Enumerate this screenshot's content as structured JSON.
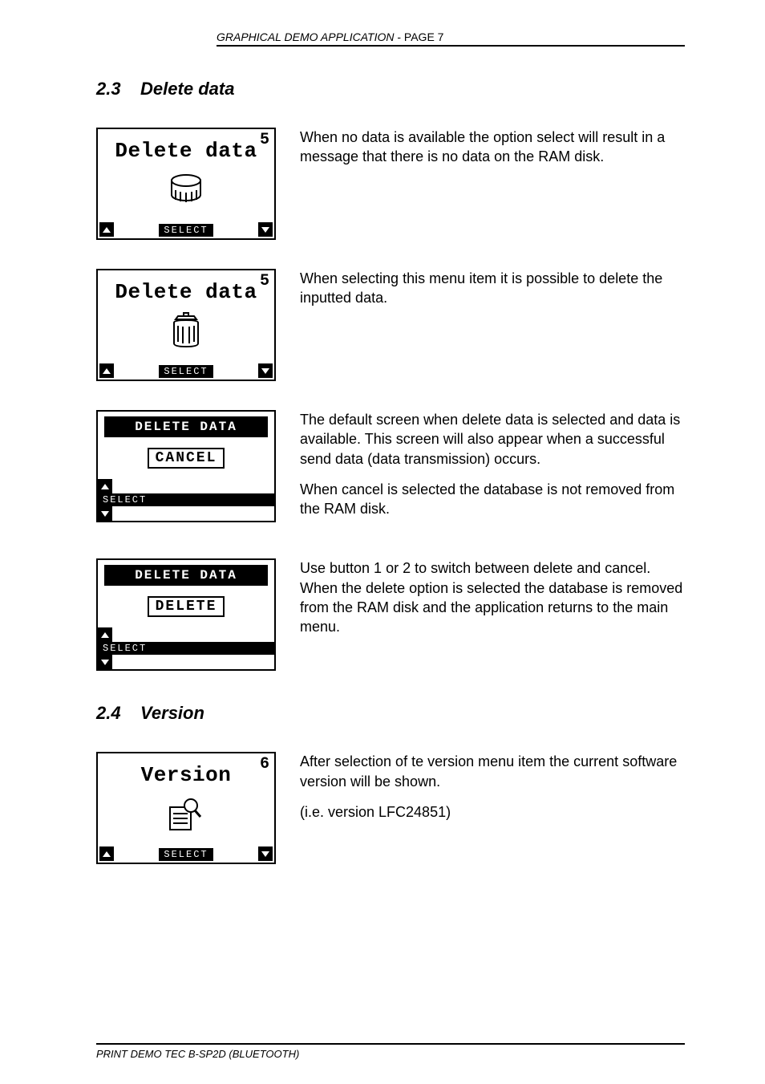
{
  "header": {
    "left_italic": "GRAPHICAL DEMO APPLICATION",
    "separator": "   -   ",
    "right": "PAGE 7"
  },
  "sections": {
    "delete": {
      "num": "2.3",
      "title": "Delete data"
    },
    "version": {
      "num": "2.4",
      "title": "Version"
    }
  },
  "lcd": {
    "select_label": "SELECT",
    "delete_title": "Delete data",
    "delete_corner": "5",
    "delete_data_bar": "DELETE DATA",
    "cancel_btn": "CANCEL",
    "delete_btn": "DELETE",
    "version_title": "Version",
    "version_corner": "6"
  },
  "para": {
    "d1": "When no data is available the option select will result in a message that there is no data on the RAM disk.",
    "d2": "When selecting this menu item it is possible to delete the inputted data.",
    "d3a": "The default screen when delete data is selected and data is available. This screen will also appear when a successful send data (data transmission) occurs.",
    "d3b": "When cancel is selected the database is not removed from the RAM disk.",
    "d4": "Use button 1 or 2 to switch between delete and cancel. When the delete option is selected the database is removed from the RAM disk and the application returns to the main menu.",
    "v1a": "After selection of te version menu item the current software version will be shown.",
    "v1b": "(i.e. version LFC24851)"
  },
  "footer": {
    "text_italic": "PRINT DEMO TEC B-SP2D (B",
    "text_smallcaps": "LUETOOTH",
    "text_tail": ")"
  }
}
